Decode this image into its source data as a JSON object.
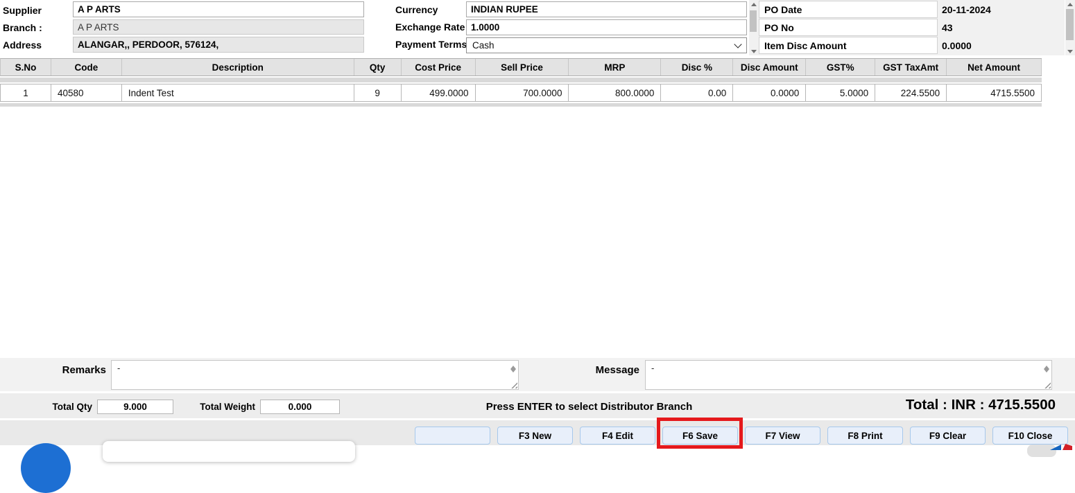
{
  "colors": {
    "accent_blue": "#1d6fd3",
    "button_bg": "#e8effa",
    "button_border": "#a6c8ec",
    "highlight_red": "#e5191c"
  },
  "header_form": {
    "supplier": {
      "label": "Supplier",
      "value": "A P ARTS"
    },
    "branch": {
      "label": "Branch :",
      "value": "A P ARTS"
    },
    "address": {
      "label": "Address",
      "value": "ALANGAR,, PERDOOR, 576124,"
    },
    "currency": {
      "label": "Currency",
      "value": "INDIAN RUPEE"
    },
    "exchange_rate": {
      "label": "Exchange Rate",
      "value": "1.0000"
    },
    "payment_terms": {
      "label": "Payment Terms",
      "value": "Cash"
    },
    "po_date": {
      "label": "PO Date",
      "value": "20-11-2024"
    },
    "po_no": {
      "label": "PO No",
      "value": "43"
    },
    "item_disc_amount": {
      "label": "Item Disc Amount",
      "value": "0.0000"
    }
  },
  "items_table": {
    "columns": [
      "S.No",
      "Code",
      "Description",
      "Qty",
      "Cost Price",
      "Sell Price",
      "MRP",
      "Disc %",
      "Disc Amount",
      "GST%",
      "GST TaxAmt",
      "Net Amount"
    ],
    "rows": [
      {
        "sno": "1",
        "code": "40580",
        "description": "Indent Test",
        "qty": "9",
        "cost_price": "499.0000",
        "sell_price": "700.0000",
        "mrp": "800.0000",
        "disc_pct": "0.00",
        "disc_amount": "0.0000",
        "gst_pct": "5.0000",
        "gst_tax_amt": "224.5500",
        "net_amount": "4715.5500"
      }
    ]
  },
  "remarks": {
    "label": "Remarks",
    "value": "-"
  },
  "message": {
    "label": "Message",
    "value": "-"
  },
  "footer": {
    "total_qty": {
      "label": "Total Qty",
      "value": "9.000"
    },
    "total_weight": {
      "label": "Total Weight",
      "value": "0.000"
    },
    "hint": "Press ENTER to select Distributor Branch",
    "grand_total": "Total : INR : 4715.5500"
  },
  "action_bar": {
    "buttons": [
      "",
      "F3 New",
      "F4 Edit",
      "F6 Save",
      "F7 View",
      "F8 Print",
      "F9 Clear",
      "F10 Close"
    ],
    "highlighted": "F6 Save"
  }
}
